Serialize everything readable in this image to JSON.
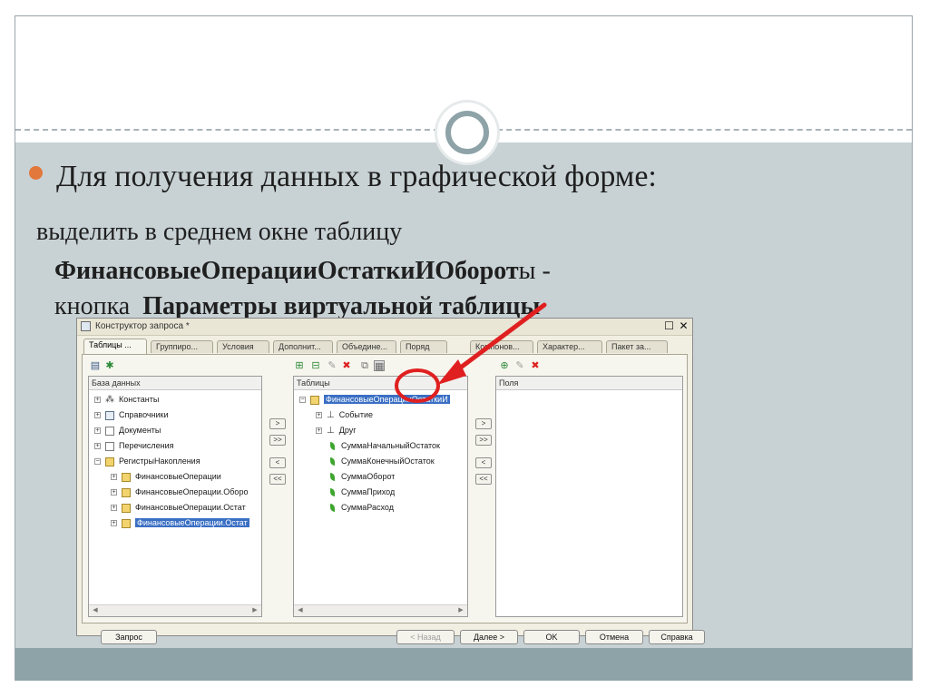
{
  "slide": {
    "heading": "Для получения данных в графической форме:",
    "line1": "выделить в среднем окне таблицу",
    "line2_bold": "ФинансовыеОперацииОстаткиИОборот",
    "line2_rest": "ы  -",
    "line3_prefix": "кнопка",
    "line3_bold": "Параметры виртуальной таблицы"
  },
  "dialog": {
    "title": "Конструктор запроса *",
    "tabs": [
      "Таблицы ...",
      "Группиро...",
      "Условия",
      "Дополнит...",
      "Объедине...",
      "Поряд",
      "Компонов...",
      "Характер...",
      "Пакет за..."
    ],
    "left_panel": {
      "header": "База данных",
      "items": [
        {
          "label": "Константы"
        },
        {
          "label": "Справочники"
        },
        {
          "label": "Документы"
        },
        {
          "label": "Перечисления"
        },
        {
          "label": "РегистрыНакопления"
        },
        {
          "label": "ФинансовыеОперации"
        },
        {
          "label": "ФинансовыеОперации.Оборо"
        },
        {
          "label": "ФинансовыеОперации.Остат"
        },
        {
          "label": "ФинансовыеОперации.Остат"
        }
      ]
    },
    "middle_panel": {
      "header": "Таблицы",
      "items": [
        {
          "label": "ФинансовыеОперацииОстаткиИ"
        },
        {
          "label": "Событие"
        },
        {
          "label": "Друг"
        },
        {
          "label": "СуммаНачальныйОстаток"
        },
        {
          "label": "СуммаКонечныйОстаток"
        },
        {
          "label": "СуммаОборот"
        },
        {
          "label": "СуммаПриход"
        },
        {
          "label": "СуммаРасход"
        }
      ]
    },
    "right_panel": {
      "header": "Поля"
    },
    "move_buttons": [
      ">",
      ">>",
      "<",
      "<<"
    ],
    "footer": {
      "query": "Запрос",
      "back": "< Назад",
      "next": "Далее >",
      "ok": "OK",
      "cancel": "Отмена",
      "help": "Справка"
    }
  },
  "colors": {
    "bullet": "#e2783b",
    "annotation": "#e02020",
    "selection": "#3a6fc4"
  }
}
